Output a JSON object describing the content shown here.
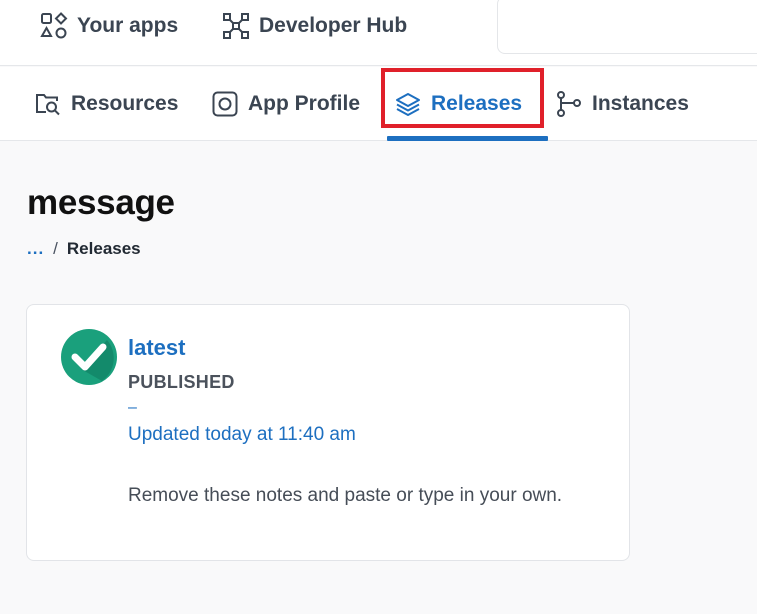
{
  "top_nav": {
    "your_apps": "Your apps",
    "developer_hub": "Developer Hub"
  },
  "tabs": [
    {
      "label": "Resources",
      "icon": "resources-search-icon"
    },
    {
      "label": "App Profile",
      "icon": "app-profile-icon"
    },
    {
      "label": "Releases",
      "icon": "layers-icon",
      "active": true
    },
    {
      "label": "Instances",
      "icon": "branch-icon"
    }
  ],
  "page": {
    "title": "message",
    "breadcrumb": {
      "ellipsis": "...",
      "separator": "/",
      "current": "Releases"
    }
  },
  "release": {
    "name": "latest",
    "status": "PUBLISHED",
    "dash": "–",
    "updated": "Updated today at 11:40 am",
    "notes": "Remove these notes and paste or type in your own.",
    "status_icon": "check-circle-icon"
  },
  "colors": {
    "accent": "#1d6fc0",
    "highlight": "#e0202a",
    "success": "#1aa07c"
  }
}
